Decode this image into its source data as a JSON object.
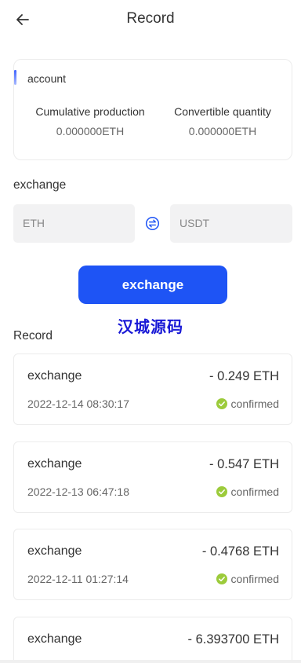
{
  "header": {
    "title": "Record",
    "back_icon": "arrow-left-icon"
  },
  "account": {
    "label": "account",
    "cumulative_label": "Cumulative production",
    "cumulative_value": "0.000000ETH",
    "convertible_label": "Convertible quantity",
    "convertible_value": "0.000000ETH"
  },
  "exchange": {
    "title": "exchange",
    "from_coin": "ETH",
    "to_coin": "USDT",
    "swap_icon": "swap-icon",
    "button_label": "exchange"
  },
  "watermark": "汉城源码",
  "records_title": "Record",
  "records": [
    {
      "type": "exchange",
      "amount": "- 0.249 ETH",
      "time": "2022-12-14 08:30:17",
      "status": "confirmed"
    },
    {
      "type": "exchange",
      "amount": "- 0.547 ETH",
      "time": "2022-12-13 06:47:18",
      "status": "confirmed"
    },
    {
      "type": "exchange",
      "amount": "- 0.4768 ETH",
      "time": "2022-12-11 01:27:14",
      "status": "confirmed"
    },
    {
      "type": "exchange",
      "amount": "- 6.393700 ETH",
      "time": "",
      "status": ""
    }
  ],
  "colors": {
    "accent": "#1e54f5",
    "confirmed": "#9ccb3b",
    "watermark": "#1a1ad6"
  }
}
